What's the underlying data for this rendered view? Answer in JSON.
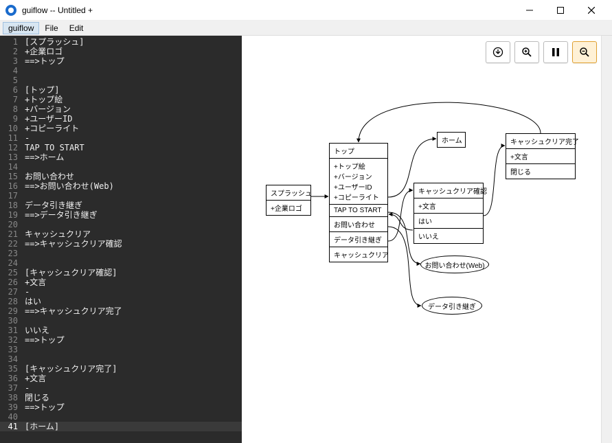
{
  "window": {
    "title": "guiflow -- Untitled +"
  },
  "menu": {
    "guiflow": "guiflow",
    "file": "File",
    "edit": "Edit"
  },
  "toolbar": {
    "download": "⬇",
    "zoom_in": "🔍",
    "pause": "⏸",
    "zoom_out": "🔍"
  },
  "editor": {
    "lines": [
      "[スプラッシュ]",
      "+企業ロゴ",
      "==>トップ",
      "",
      "",
      "[トップ]",
      "+トップ絵",
      "+バージョン",
      "+ユーザーID",
      "+コピーライト",
      "-",
      "TAP TO START",
      "==>ホーム",
      "",
      "お問い合わせ",
      "==>お問い合わせ(Web)",
      "",
      "データ引き継ぎ",
      "==>データ引き継ぎ",
      "",
      "キャッシュクリア",
      "==>キャッシュクリア確認",
      "",
      "",
      "[キャッシュクリア確認]",
      "+文言",
      "-",
      "はい",
      "==>キャッシュクリア完了",
      "",
      "いいえ",
      "==>トップ",
      "",
      "",
      "[キャッシュクリア完了]",
      "+文言",
      "-",
      "閉じる",
      "==>トップ",
      "",
      "[ホーム]"
    ],
    "current_line": 41
  },
  "diagram": {
    "nodes": {
      "splash": {
        "title": "スプラッシュ",
        "rows": [
          "+企業ロゴ"
        ]
      },
      "top": {
        "title": "トップ",
        "rows": [
          "+トップ絵",
          "+バージョン",
          "+ユーザーID",
          "+コピーライト",
          "TAP TO START",
          "お問い合わせ",
          "データ引き継ぎ",
          "キャッシュクリア"
        ]
      },
      "home": {
        "title": "ホーム",
        "rows": []
      },
      "confirm": {
        "title": "キャッシュクリア確認",
        "rows": [
          "+文言",
          "はい",
          "いいえ"
        ]
      },
      "done": {
        "title": "キャッシュクリア完了",
        "rows": [
          "+文言",
          "閉じる"
        ]
      },
      "inquiry": {
        "title": "お問い合わせ(Web)"
      },
      "datainh": {
        "title": "データ引き継ぎ"
      }
    }
  }
}
